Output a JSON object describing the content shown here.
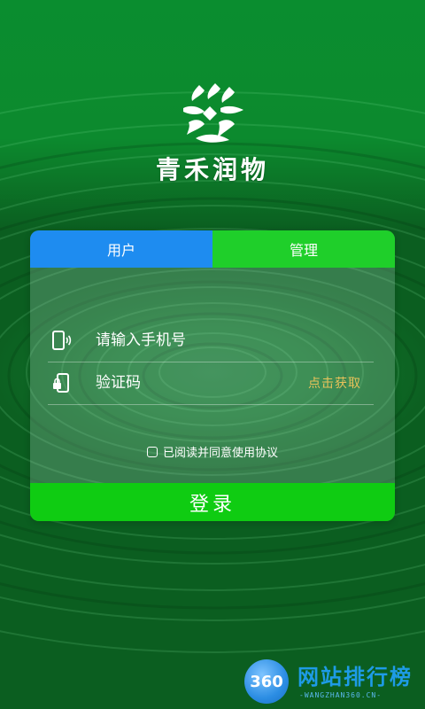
{
  "brand": {
    "name": "青禾润物",
    "logo_icon": "qinghe-logo-icon"
  },
  "tabs": [
    {
      "label": "用户",
      "active": true
    },
    {
      "label": "管理",
      "active": false
    }
  ],
  "form": {
    "phone_placeholder": "请输入手机号",
    "phone_icon": "phone-icon",
    "code_placeholder": "验证码",
    "code_icon": "lock-phone-icon",
    "get_code_label": "点击获取",
    "agree_label": "已阅读并同意使用协议",
    "agree_checked": false,
    "submit_label": "登录"
  },
  "watermark": {
    "badge": "360",
    "title": "网站排行榜",
    "subtitle": "-WANGZHAN360.CN-"
  },
  "colors": {
    "tab_user": "#1e8cf0",
    "tab_admin": "#1fcf2a",
    "login_button": "#0fcc12",
    "get_code": "#e8c25a"
  }
}
